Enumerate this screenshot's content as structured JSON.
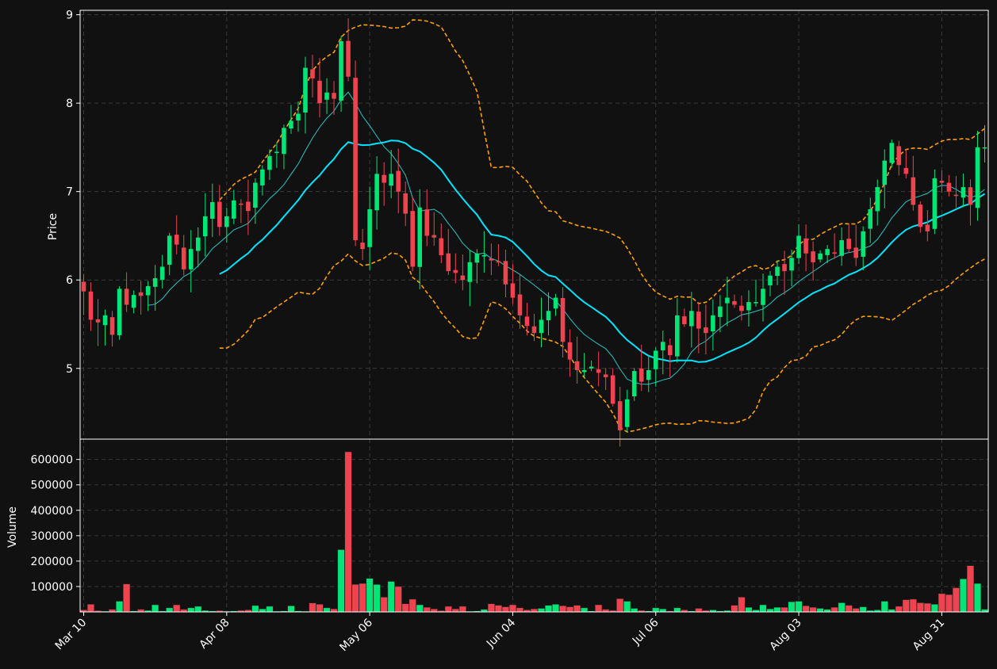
{
  "chart_data": {
    "type": "candlestick",
    "title": "",
    "price_panel": {
      "ylabel": "Price",
      "ylim": [
        4.2,
        9.05
      ],
      "yticks": [
        "5",
        "6",
        "7",
        "8",
        "9"
      ],
      "grid": true
    },
    "volume_panel": {
      "ylabel": "Volume",
      "ylim": [
        0,
        680000
      ],
      "yticks": [
        "100000",
        "200000",
        "300000",
        "400000",
        "500000",
        "600000"
      ],
      "grid": true
    },
    "x_axis": {
      "num_sessions": 127,
      "tick_labels": [
        "Mar 10",
        "Apr 08",
        "May 06",
        "Jun 04",
        "Jul 06",
        "Aug 03",
        "Aug 31"
      ],
      "tick_index": [
        0,
        20,
        40,
        60,
        80,
        100,
        120
      ]
    },
    "colors": {
      "up": "#00e676",
      "down": "#ef4350",
      "ma_short": "#26c6c6",
      "ma_long": "#00e5ff",
      "bollinger": "#ffa000",
      "background": "#111111",
      "text": "#ffffff",
      "grid": "#3a3a3a"
    },
    "close_path": [
      [
        0,
        5.87
      ],
      [
        1,
        5.55
      ],
      [
        2,
        5.52
      ],
      [
        3,
        5.6
      ],
      [
        4,
        5.38
      ],
      [
        5,
        5.9
      ],
      [
        6,
        5.72
      ],
      [
        7,
        5.83
      ],
      [
        8,
        5.82
      ],
      [
        9,
        5.93
      ],
      [
        10,
        6.02
      ],
      [
        11,
        6.15
      ],
      [
        12,
        6.5
      ],
      [
        13,
        6.4
      ],
      [
        14,
        6.12
      ],
      [
        15,
        6.35
      ],
      [
        16,
        6.48
      ],
      [
        17,
        6.72
      ],
      [
        18,
        6.88
      ],
      [
        19,
        6.6
      ],
      [
        20,
        6.72
      ],
      [
        21,
        6.9
      ],
      [
        22,
        6.85
      ],
      [
        23,
        6.78
      ],
      [
        24,
        7.1
      ],
      [
        25,
        7.25
      ],
      [
        26,
        7.4
      ],
      [
        27,
        7.45
      ],
      [
        28,
        7.72
      ],
      [
        29,
        7.8
      ],
      [
        30,
        7.88
      ],
      [
        31,
        8.4
      ],
      [
        32,
        8.28
      ],
      [
        33,
        8.0
      ],
      [
        34,
        8.12
      ],
      [
        35,
        8.05
      ],
      [
        36,
        8.7
      ],
      [
        37,
        8.3
      ],
      [
        38,
        6.45
      ],
      [
        39,
        6.35
      ],
      [
        40,
        6.8
      ],
      [
        41,
        7.2
      ],
      [
        42,
        7.1
      ],
      [
        43,
        7.2
      ],
      [
        44,
        7.0
      ],
      [
        45,
        6.75
      ],
      [
        46,
        6.15
      ],
      [
        47,
        6.82
      ],
      [
        48,
        6.5
      ],
      [
        49,
        6.48
      ],
      [
        50,
        6.28
      ],
      [
        51,
        6.1
      ],
      [
        52,
        6.08
      ],
      [
        53,
        6.0
      ],
      [
        54,
        6.2
      ],
      [
        55,
        6.3
      ],
      [
        56,
        6.28
      ],
      [
        57,
        6.22
      ],
      [
        58,
        6.2
      ],
      [
        59,
        5.95
      ],
      [
        60,
        5.8
      ],
      [
        61,
        5.6
      ],
      [
        62,
        5.48
      ],
      [
        63,
        5.4
      ],
      [
        64,
        5.55
      ],
      [
        65,
        5.65
      ],
      [
        66,
        5.8
      ],
      [
        67,
        5.3
      ],
      [
        68,
        5.1
      ],
      [
        69,
        4.98
      ],
      [
        70,
        4.98
      ],
      [
        71,
        5.02
      ],
      [
        72,
        4.95
      ],
      [
        73,
        4.9
      ],
      [
        74,
        4.6
      ],
      [
        75,
        4.3
      ],
      [
        76,
        4.65
      ],
      [
        77,
        4.97
      ],
      [
        78,
        4.85
      ],
      [
        79,
        4.98
      ],
      [
        80,
        5.2
      ],
      [
        81,
        5.3
      ],
      [
        82,
        5.15
      ],
      [
        83,
        5.6
      ],
      [
        84,
        5.5
      ],
      [
        85,
        5.65
      ],
      [
        86,
        5.45
      ],
      [
        87,
        5.4
      ],
      [
        88,
        5.6
      ],
      [
        89,
        5.7
      ],
      [
        90,
        5.8
      ],
      [
        91,
        5.72
      ],
      [
        92,
        5.65
      ],
      [
        93,
        5.75
      ],
      [
        94,
        5.75
      ],
      [
        95,
        5.9
      ],
      [
        96,
        6.05
      ],
      [
        97,
        6.15
      ],
      [
        98,
        6.1
      ],
      [
        99,
        6.25
      ],
      [
        100,
        6.5
      ],
      [
        101,
        6.3
      ],
      [
        102,
        6.2
      ],
      [
        103,
        6.3
      ],
      [
        104,
        6.35
      ],
      [
        105,
        6.3
      ],
      [
        106,
        6.45
      ],
      [
        107,
        6.35
      ],
      [
        108,
        6.25
      ],
      [
        109,
        6.55
      ],
      [
        110,
        6.8
      ],
      [
        111,
        7.05
      ],
      [
        112,
        7.35
      ],
      [
        113,
        7.55
      ],
      [
        114,
        7.3
      ],
      [
        115,
        7.2
      ],
      [
        116,
        6.85
      ],
      [
        117,
        6.6
      ],
      [
        118,
        6.55
      ],
      [
        119,
        7.15
      ],
      [
        120,
        7.1
      ],
      [
        121,
        7.0
      ],
      [
        122,
        6.95
      ],
      [
        123,
        7.05
      ],
      [
        124,
        6.85
      ],
      [
        125,
        7.5
      ],
      [
        126,
        7.5
      ]
    ],
    "volume_path": [
      [
        0,
        8000
      ],
      [
        1,
        30000
      ],
      [
        2,
        5000
      ],
      [
        3,
        3000
      ],
      [
        4,
        10000
      ],
      [
        5,
        42000
      ],
      [
        6,
        110000
      ],
      [
        7,
        4000
      ],
      [
        8,
        10000
      ],
      [
        9,
        6000
      ],
      [
        10,
        28000
      ],
      [
        11,
        4000
      ],
      [
        12,
        16000
      ],
      [
        13,
        28000
      ],
      [
        14,
        10000
      ],
      [
        15,
        16000
      ],
      [
        16,
        22000
      ],
      [
        17,
        6000
      ],
      [
        18,
        4000
      ],
      [
        19,
        5000
      ],
      [
        20,
        3000
      ],
      [
        21,
        4000
      ],
      [
        22,
        6000
      ],
      [
        23,
        8000
      ],
      [
        24,
        25000
      ],
      [
        25,
        12000
      ],
      [
        26,
        22000
      ],
      [
        27,
        3000
      ],
      [
        28,
        4000
      ],
      [
        29,
        24000
      ],
      [
        30,
        4000
      ],
      [
        31,
        3000
      ],
      [
        32,
        35000
      ],
      [
        33,
        30000
      ],
      [
        34,
        16000
      ],
      [
        35,
        12000
      ],
      [
        36,
        245000
      ],
      [
        37,
        630000
      ],
      [
        38,
        108000
      ],
      [
        39,
        112000
      ],
      [
        40,
        132000
      ],
      [
        41,
        108000
      ],
      [
        42,
        58000
      ],
      [
        43,
        120000
      ],
      [
        44,
        100000
      ],
      [
        45,
        32000
      ],
      [
        46,
        50000
      ],
      [
        47,
        28000
      ],
      [
        48,
        18000
      ],
      [
        49,
        12000
      ],
      [
        50,
        5000
      ],
      [
        51,
        22000
      ],
      [
        52,
        12000
      ],
      [
        53,
        22000
      ],
      [
        54,
        3000
      ],
      [
        55,
        4000
      ],
      [
        56,
        10000
      ],
      [
        57,
        32000
      ],
      [
        58,
        26000
      ],
      [
        59,
        20000
      ],
      [
        60,
        28000
      ],
      [
        61,
        16000
      ],
      [
        62,
        8000
      ],
      [
        63,
        12000
      ],
      [
        64,
        14000
      ],
      [
        65,
        26000
      ],
      [
        66,
        30000
      ],
      [
        67,
        24000
      ],
      [
        68,
        20000
      ],
      [
        69,
        26000
      ],
      [
        70,
        16000
      ],
      [
        71,
        4000
      ],
      [
        72,
        28000
      ],
      [
        73,
        10000
      ],
      [
        74,
        6000
      ],
      [
        75,
        52000
      ],
      [
        76,
        42000
      ],
      [
        77,
        14000
      ],
      [
        78,
        6000
      ],
      [
        79,
        4000
      ],
      [
        80,
        16000
      ],
      [
        81,
        12000
      ],
      [
        82,
        4000
      ],
      [
        83,
        16000
      ],
      [
        84,
        8000
      ],
      [
        85,
        4000
      ],
      [
        86,
        14000
      ],
      [
        87,
        6000
      ],
      [
        88,
        8000
      ],
      [
        89,
        4000
      ],
      [
        90,
        6000
      ],
      [
        91,
        26000
      ],
      [
        92,
        58000
      ],
      [
        93,
        18000
      ],
      [
        94,
        8000
      ],
      [
        95,
        28000
      ],
      [
        96,
        12000
      ],
      [
        97,
        18000
      ],
      [
        98,
        18000
      ],
      [
        99,
        40000
      ],
      [
        100,
        42000
      ],
      [
        101,
        24000
      ],
      [
        102,
        18000
      ],
      [
        103,
        14000
      ],
      [
        104,
        10000
      ],
      [
        105,
        18000
      ],
      [
        106,
        36000
      ],
      [
        107,
        26000
      ],
      [
        108,
        14000
      ],
      [
        109,
        20000
      ],
      [
        110,
        6000
      ],
      [
        111,
        8000
      ],
      [
        112,
        42000
      ],
      [
        113,
        10000
      ],
      [
        114,
        22000
      ],
      [
        115,
        48000
      ],
      [
        116,
        50000
      ],
      [
        117,
        36000
      ],
      [
        118,
        34000
      ],
      [
        119,
        30000
      ],
      [
        120,
        72000
      ],
      [
        121,
        68000
      ],
      [
        122,
        95000
      ],
      [
        123,
        130000
      ],
      [
        124,
        182000
      ],
      [
        125,
        112000
      ],
      [
        126,
        10000
      ]
    ]
  }
}
